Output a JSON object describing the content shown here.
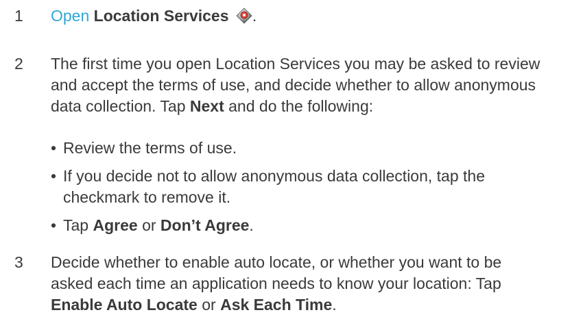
{
  "steps": [
    {
      "number": "1",
      "link": "Open",
      "bold": "Location Services",
      "icon": "location-services-icon",
      "end": "."
    },
    {
      "number": "2",
      "line1": "The first time you open Location Services you may be asked to review",
      "line2": "and accept the terms of use, and decide whether to allow anonymous",
      "line3_pre": "data collection. Tap ",
      "line3_bold": "Next",
      "line3_post": " and do the following:",
      "bullets": {
        "b1": "Review the terms of use.",
        "b2_line1": "If you decide not to allow anonymous data collection, tap the",
        "b2_line2": "checkmark to remove it.",
        "b3_pre": "Tap ",
        "b3_bold1": "Agree",
        "b3_mid": " or ",
        "b3_bold2": "Don’t Agree",
        "b3_end": "."
      }
    },
    {
      "number": "3",
      "line1": "Decide whether to enable auto locate, or whether you want to be",
      "line2": "asked each time an application needs to know your location: Tap",
      "bold1": "Enable Auto Locate",
      "mid": " or ",
      "bold2": "Ask Each Time",
      "end": "."
    }
  ],
  "bullet_char": "•",
  "colors": {
    "text": "#3a3a3a",
    "link": "#2fa8d5"
  }
}
